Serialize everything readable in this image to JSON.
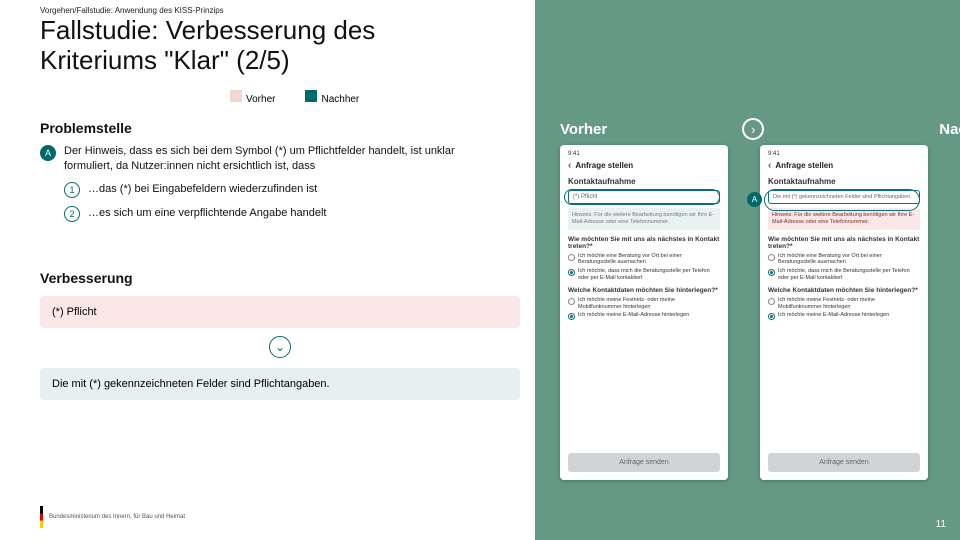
{
  "breadcrumb": "Vorgehen/Fallstudie: Anwendung des KISS-Prinzips",
  "title": "Fallstudie: Verbesserung des Kriteriums \"Klar\" (2/5)",
  "legend": {
    "vorher": "Vorher",
    "nachher": "Nachher"
  },
  "problem": {
    "heading": "Problemstelle",
    "badgeA": "A",
    "textA": "Der Hinweis, dass es sich bei dem Symbol (*) um Pflichtfelder handelt, ist unklar formuliert, da Nutzer:innen nicht ersichtlich ist, dass",
    "bullet1_badge": "1",
    "bullet1": "…das (*) bei Eingabefeldern wiederzufinden ist",
    "bullet2_badge": "2",
    "bullet2": "…es sich um eine verpflichtende Angabe handelt"
  },
  "improve": {
    "heading": "Verbesserung",
    "before": "(*) Pflicht",
    "after": "Die mit (*) gekennzeichneten Felder sind Pflichtangaben."
  },
  "right": {
    "vorher": "Vorher",
    "nachher": "Nachher",
    "markerA": "A"
  },
  "phone": {
    "time": "9:41",
    "title": "Anfrage stellen",
    "group": "Kontaktaufnahme",
    "field_before": "(*) Pflicht",
    "note_before": "Hinweis: Für die weitere Bearbeitung benötigen wir Ihre E-Mail-Adresse oder eine Telefonnummer.",
    "field_after": "Die mit (*) gekennzeichneten Felder sind Pflichtangaben.",
    "note_after": "Hinweis: Für die weitere Bearbeitung benötigen wir Ihre E-Mail-Adresse oder eine Telefonnummer.",
    "q1": "Wie möchten Sie mit uns als nächstes in Kontakt treten?*",
    "q1o1": "Ich möchte eine Beratung vor Ort bei einer Beratungsstelle ausmachen",
    "q1o2": "Ich möchte, dass mich die Beratungsstelle per Telefon oder per E-Mail kontaktiert",
    "q2": "Welche Kontaktdaten möchten Sie hinterlegen?*",
    "q2o1": "Ich möchte meine Festnetz- oder meine Mobilfunknummer hinterlegen",
    "q2o2": "Ich möchte meine E-Mail-Adresse hinterlegen",
    "button": "Anfrage senden"
  },
  "logo": "Bundesministerium des Innern, für Bau und Heimat",
  "page": "11"
}
